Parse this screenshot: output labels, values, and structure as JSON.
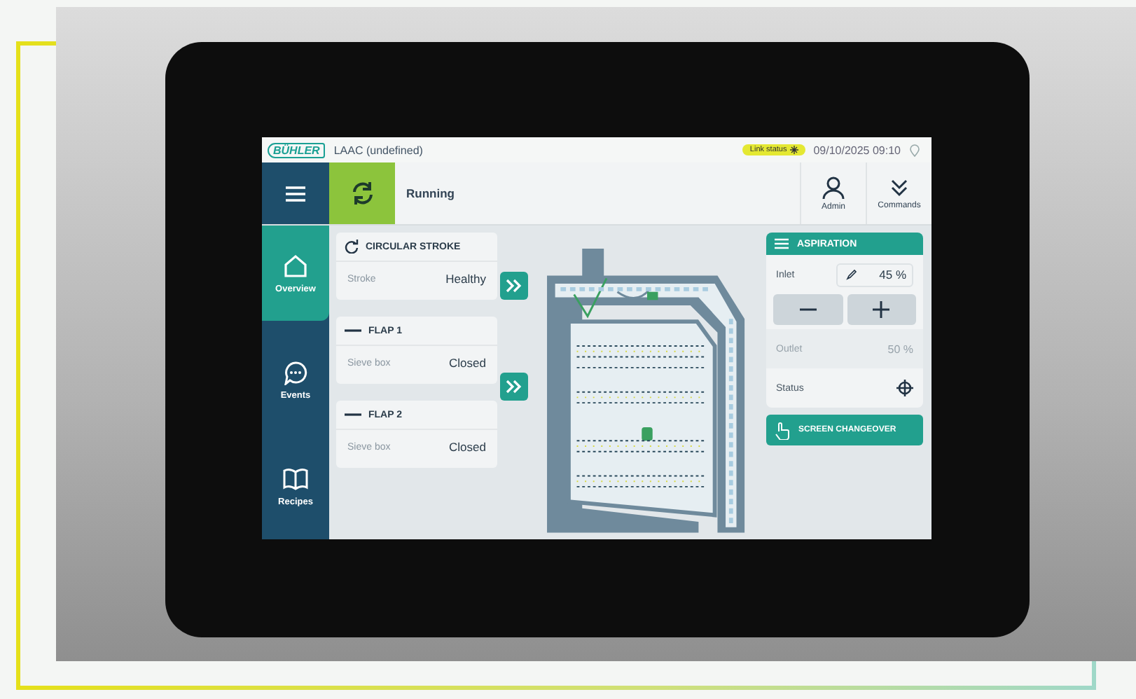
{
  "header": {
    "logo": "BÜHLER",
    "title": "LAAC (undefined)",
    "link_status": "Link status",
    "datetime": "09/10/2025 09:10"
  },
  "toolbar": {
    "status": "Running",
    "buttons": [
      {
        "label": "Admin",
        "kind": "user"
      },
      {
        "label": "Commands",
        "kind": "commands"
      }
    ]
  },
  "sidebar": {
    "items": [
      {
        "label": "Overview",
        "kind": "home",
        "selected": true
      },
      {
        "label": "Events",
        "kind": "chat",
        "selected": false
      },
      {
        "label": "Recipes",
        "kind": "book",
        "selected": false
      }
    ]
  },
  "cards": [
    {
      "title": "CIRCULAR STROKE",
      "kind": "refresh",
      "label": "Stroke",
      "value": "Healthy"
    },
    {
      "title": "FLAP 1",
      "kind": "dash",
      "label": "Sieve box",
      "value": "Closed"
    },
    {
      "title": "FLAP 2",
      "kind": "dash",
      "label": "Sieve box",
      "value": "Closed"
    }
  ],
  "aspiration": {
    "title": "ASPIRATION",
    "rows": [
      {
        "label": "Inlet",
        "value": "45 %",
        "kind": "edit",
        "disabled": false
      },
      {
        "kind": "stepper"
      },
      {
        "label": "Outlet",
        "value": "50 %",
        "kind": "value",
        "disabled": true
      },
      {
        "label": "Status",
        "kind": "target",
        "disabled": false
      }
    ],
    "button": "SCREEN CHANGEOVER"
  }
}
